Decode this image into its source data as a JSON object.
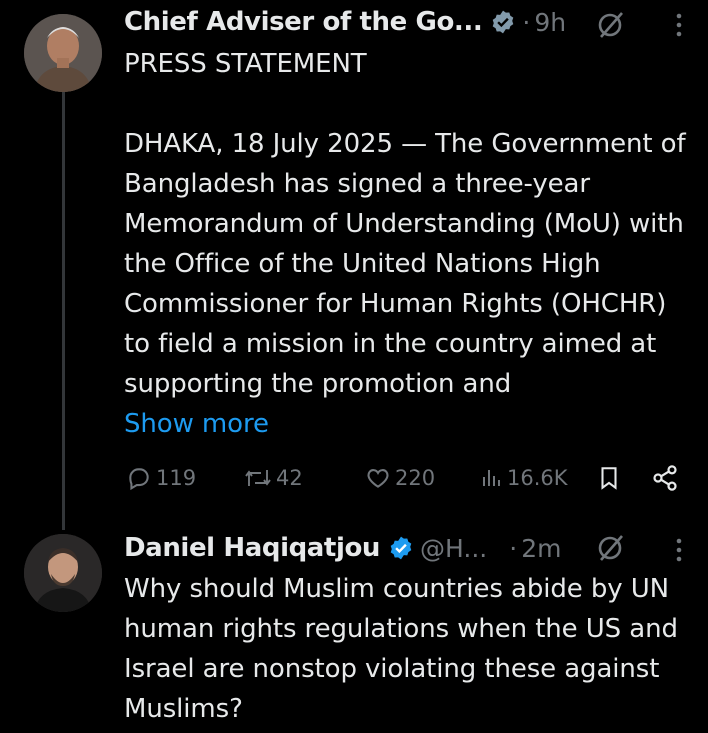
{
  "tweet1": {
    "author_name": "Chief Adviser of the Go...",
    "separator": "·",
    "time": "9h",
    "paragraphs": [
      "PRESS STATEMENT",
      "DHAKA, 18 July 2025 — The Government of Bangladesh has signed a three-year Memorandum of Understanding (MoU) with the Office of the United Nations High Commissioner for Human Rights (OHCHR) to field a mission in the country aimed at supporting the promotion and"
    ],
    "show_more": "Show more",
    "replies": "119",
    "reposts": "42",
    "likes": "220",
    "views": "16.6K"
  },
  "tweet2": {
    "author_name": "Daniel Haqiqatjou",
    "handle": "@H...",
    "separator": "·",
    "time": "2m",
    "text": "Why should Muslim countries abide by UN human rights regulations when the US and Israel are nonstop violating these against Muslims?"
  },
  "colors": {
    "background": "#000000",
    "text": "#e7e9ea",
    "muted": "#71767b",
    "link": "#1d9bf0",
    "verified_gray": "#829aab",
    "verified_blue": "#1d9bf0",
    "thread_line": "#333639"
  },
  "icons": [
    "verified-gray-badge-icon",
    "verified-blue-badge-icon",
    "grok-icon",
    "more-icon",
    "reply-icon",
    "repost-icon",
    "like-icon",
    "views-icon",
    "bookmark-icon",
    "share-icon"
  ]
}
